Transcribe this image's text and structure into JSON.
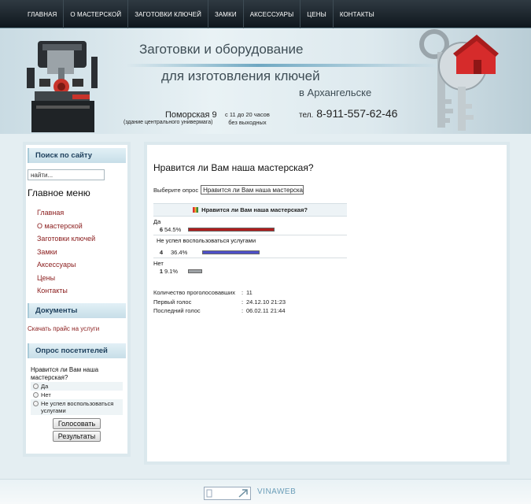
{
  "nav": {
    "items": [
      "ГЛАВНАЯ",
      "О МАСТЕРСКОЙ",
      "ЗАГОТОВКИ КЛЮЧЕЙ",
      "ЗАМКИ",
      "АКСЕССУАРЫ",
      "ЦЕНЫ",
      "КОНТАКТЫ"
    ]
  },
  "header": {
    "line1": "Заготовки и оборудование",
    "line2": "для изготовления ключей",
    "line3": "в Архангельске",
    "address": "Поморская 9",
    "address_note": "(здание центрального универмага)",
    "hours_line1": "с 11 до 20 часов",
    "hours_line2": "без выходных",
    "phone_label": "тел.",
    "phone": "8-911-557-62-46"
  },
  "sidebar": {
    "search_title": "Поиск по сайту",
    "search_value": "найти...",
    "menu_title": "Главное меню",
    "menu_items": [
      "Главная",
      "О мастерской",
      "Заготовки ключей",
      "Замки",
      "Аксессуары",
      "Цены",
      "Контакты"
    ],
    "docs_title": "Документы",
    "docs_link": "Скачать прайс на услуги",
    "poll_title": "Опрос посетителей",
    "poll_question": "Нравится ли Вам наша мастерская?",
    "poll_options": [
      "Да",
      "Нет",
      "Не успел воспользоваться услугами"
    ],
    "vote_button": "Голосовать",
    "results_button": "Результаты"
  },
  "main": {
    "title": "Нравится ли Вам наша мастерская?",
    "select_label": "Выберите опрос",
    "select_value": "Нравится ли Вам наша мастерская?",
    "results_header": "Нравится ли Вам наша мастерская?",
    "results": [
      {
        "label": "Да",
        "count": "6",
        "percent": "54.5%",
        "fraction": 0.545,
        "color": "red"
      },
      {
        "label": "Не успел воспользоваться услугами",
        "count": "4",
        "percent": "36.4%",
        "fraction": 0.364,
        "color": "blue"
      },
      {
        "label": "Нет",
        "count": "1",
        "percent": "9.1%",
        "fraction": 0.091,
        "color": "grey"
      }
    ],
    "stats": [
      {
        "key": "Количество проголосовавших",
        "value": "11"
      },
      {
        "key": "Первый голос",
        "value": "24.12.10 21:23"
      },
      {
        "key": "Последний голос",
        "value": "06.02.11 21:44"
      }
    ]
  },
  "footer": {
    "logo": "VINAWEB"
  }
}
